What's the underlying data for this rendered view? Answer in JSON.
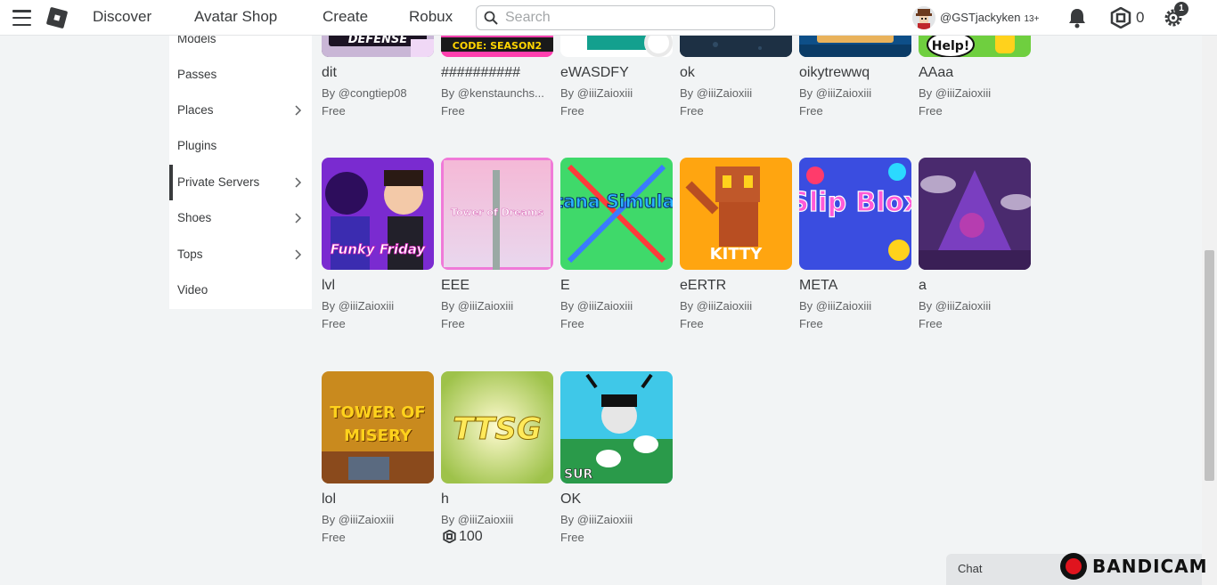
{
  "topbar": {
    "nav": [
      "Discover",
      "Avatar Shop",
      "Create",
      "Robux"
    ],
    "search_placeholder": "Search",
    "username": "@GSTjackyken",
    "age_badge": "13+",
    "robux_balance": "0",
    "settings_badge": "1"
  },
  "sidebar": {
    "items": [
      {
        "label": "Models",
        "chevron": false,
        "active": false
      },
      {
        "label": "Passes",
        "chevron": false,
        "active": false
      },
      {
        "label": "Places",
        "chevron": true,
        "active": false
      },
      {
        "label": "Plugins",
        "chevron": false,
        "active": false
      },
      {
        "label": "Private Servers",
        "chevron": true,
        "active": true
      },
      {
        "label": "Shoes",
        "chevron": true,
        "active": false
      },
      {
        "label": "Tops",
        "chevron": true,
        "active": false
      },
      {
        "label": "Video",
        "chevron": false,
        "active": false
      }
    ]
  },
  "items": [
    {
      "name": "dit",
      "creator": "By @congtiep08",
      "price": "Free",
      "thumb": "tower-defense",
      "thumb_text": "DEFENSE"
    },
    {
      "name": "##########",
      "creator": "By @kenstaunchs...",
      "price": "Free",
      "thumb": "code-season2",
      "thumb_text": "CODE: SEASON2"
    },
    {
      "name": "eWASDFY",
      "creator": "By @iiiZaioxiii",
      "price": "Free",
      "thumb": "teal-block",
      "thumb_text": ""
    },
    {
      "name": "ok",
      "creator": "By @iiiZaioxiii",
      "price": "Free",
      "thumb": "dark-scene",
      "thumb_text": ""
    },
    {
      "name": "oikytrewwq",
      "creator": "By @iiiZaioxiii",
      "price": "Free",
      "thumb": "blue-sign",
      "thumb_text": ""
    },
    {
      "name": "AAaa",
      "creator": "By @iiiZaioxiii",
      "price": "Free",
      "thumb": "help-green",
      "thumb_text": "Help!"
    },
    {
      "name": "lvl",
      "creator": "By @iiiZaioxiii",
      "price": "Free",
      "thumb": "funky-friday",
      "thumb_text": "Funky Friday"
    },
    {
      "name": "EEE",
      "creator": "By @iiiZaioxiii",
      "price": "Free",
      "thumb": "tower-of-dreams",
      "thumb_text": "Tower of Dreams"
    },
    {
      "name": "E",
      "creator": "By @iiiZaioxiii",
      "price": "Free",
      "thumb": "katana-simulator",
      "thumb_text": "Katana Simulator"
    },
    {
      "name": "eERTR",
      "creator": "By @iiiZaioxiii",
      "price": "Free",
      "thumb": "kitty",
      "thumb_text": "KITTY"
    },
    {
      "name": "META",
      "creator": "By @iiiZaioxiii",
      "price": "Free",
      "thumb": "slip-blox",
      "thumb_text": "Slip Blox"
    },
    {
      "name": "a",
      "creator": "By @iiiZaioxiii",
      "price": "Free",
      "thumb": "purple-pyramid",
      "thumb_text": ""
    },
    {
      "name": "lol",
      "creator": "By @iiiZaioxiii",
      "price": "Free",
      "thumb": "tower-of-misery",
      "thumb_text": "TOWER OF MISERY"
    },
    {
      "name": "h",
      "creator": "By @iiiZaioxiii",
      "price": "100",
      "price_is_robux": true,
      "thumb": "ttsg",
      "thumb_text": "TTSG"
    },
    {
      "name": "OK",
      "creator": "By @iiiZaioxiii",
      "price": "Free",
      "thumb": "sur",
      "thumb_text": "SUR"
    }
  ],
  "chat": {
    "label": "Chat"
  },
  "watermark": {
    "text": "BANDICAM"
  },
  "colors": {
    "accent": "#393b3d",
    "background": "#f2f4f5",
    "bandicam_red": "#e0141e"
  }
}
